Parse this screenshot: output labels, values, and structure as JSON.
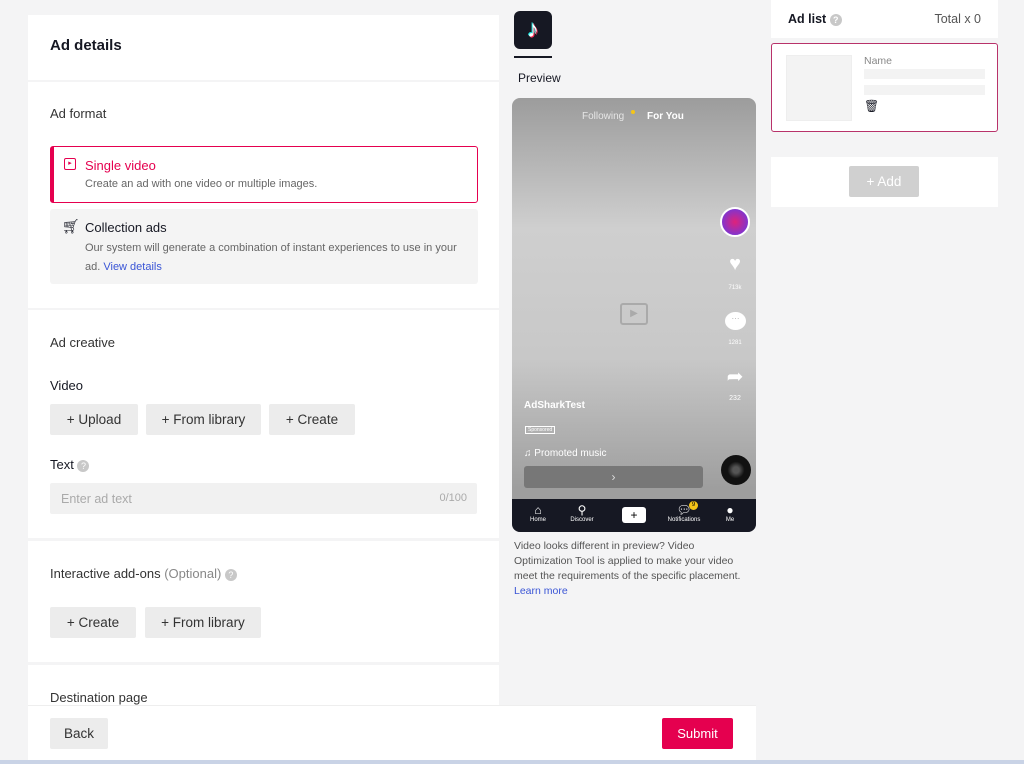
{
  "ad_details": {
    "title": "Ad details",
    "ad_format": {
      "label": "Ad format",
      "options": [
        {
          "title": "Single video",
          "desc": "Create an ad with one video or multiple images.",
          "selected": true
        },
        {
          "title": "Collection ads",
          "desc": "Our system will generate a combination of instant experiences to use in your ad.",
          "link": "View details",
          "selected": false
        }
      ]
    },
    "ad_creative": {
      "label": "Ad creative",
      "video_label": "Video",
      "video_buttons": [
        "+ Upload",
        "+ From library",
        "+ Create"
      ],
      "text_label": "Text",
      "text_placeholder": "Enter ad text",
      "text_counter": "0/100"
    },
    "interactive": {
      "label": "Interactive add-ons",
      "optional": "(Optional)",
      "buttons": [
        "+ Create",
        "+ From library"
      ]
    },
    "destination": {
      "label": "Destination page"
    }
  },
  "footer": {
    "back": "Back",
    "submit": "Submit"
  },
  "preview": {
    "tab": "Preview",
    "phone": {
      "following": "Following",
      "for_you": "For You",
      "likes": "713k",
      "comments": "1281",
      "shares": "232",
      "account": "AdSharkTest",
      "sponsored": "Sponsored",
      "music": "Promoted music",
      "cta": "›",
      "nav": [
        "Home",
        "Discover",
        "+",
        "Notifications",
        "Me"
      ],
      "notif_badge": "9"
    },
    "note": "Video looks different in preview? Video Optimization Tool is applied to make your video meet the requirements of the specific placement.",
    "note_link": "Learn more"
  },
  "ad_list": {
    "title": "Ad list",
    "total": "Total x 0",
    "card": {
      "name_label": "Name"
    },
    "add": "+ Add"
  },
  "colors": {
    "accent": "#e5004f",
    "link": "#3a55d6"
  }
}
